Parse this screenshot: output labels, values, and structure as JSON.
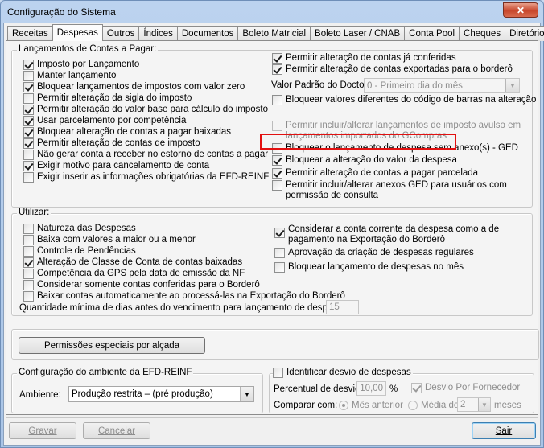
{
  "window": {
    "title": "Configuração do Sistema",
    "close_glyph": "✕"
  },
  "tabs": [
    "Receitas",
    "Despesas",
    "Outros",
    "Índices",
    "Documentos",
    "Boleto Matricial",
    "Boleto Laser / CNAB",
    "Conta Pool",
    "Cheques",
    "Diretórios"
  ],
  "lancamentos": {
    "title": "Lançamentos de Contas a Pagar:",
    "left": [
      {
        "label": "Imposto por Lançamento",
        "checked": true
      },
      {
        "label": "Manter lançamento",
        "checked": false
      },
      {
        "label": "Bloquear lançamentos de impostos com valor zero",
        "checked": true
      },
      {
        "label": "Permitir alteração da sigla do imposto",
        "checked": false
      },
      {
        "label": "Permitir alteração do valor base para cálculo do imposto",
        "checked": true
      },
      {
        "label": "Usar parcelamento por competência",
        "checked": true
      },
      {
        "label": "Bloquear alteração de contas a pagar baixadas",
        "checked": true
      },
      {
        "label": "Permitir alteração de contas de imposto",
        "checked": true
      },
      {
        "label": "Não gerar conta a receber no estorno de contas a pagar",
        "checked": false
      },
      {
        "label": "Exigir motivo para cancelamento de conta",
        "checked": true
      },
      {
        "label": "Exigir inserir as informações obrigatórias da EFD-REINF",
        "checked": false
      }
    ],
    "right_top": [
      {
        "label": "Permitir alteração de contas já conferidas",
        "checked": true
      },
      {
        "label": "Permitir alteração de contas exportadas para o borderô",
        "checked": true
      }
    ],
    "valor_padrao_label": "Valor Padrão do Docto.",
    "valor_padrao_value": "0 - Primeiro dia do mês",
    "bloquear_codigo_barras": {
      "label": "Bloquear valores diferentes do código de barras na alteração",
      "checked": false
    },
    "permitir_avulso": {
      "line1": "Permitir incluir/alterar lançamentos de imposto avulso em",
      "line2": "lançamentos importados do GCompras",
      "checked": false
    },
    "bloquear_sem_anexo": {
      "label": "Bloquear o lançamento de despesa sem anexo(s) - GED",
      "checked": false
    },
    "bloquear_valor_despesa": {
      "label": "Bloquear a alteração do valor da despesa",
      "checked": true
    },
    "permitir_parcelada": {
      "label": "Permitir alteração de contas a pagar parcelada",
      "checked": true
    },
    "permitir_anexos": {
      "line1": "Permitir incluir/alterar anexos GED para usuários com",
      "line2": "permissão de consulta",
      "checked": false
    }
  },
  "utilizar": {
    "title": "Utilizar:",
    "left": [
      {
        "label": "Natureza das Despesas",
        "checked": false
      },
      {
        "label": "Baixa com valores a maior ou a menor",
        "checked": false
      },
      {
        "label": "Controle de Pendências",
        "checked": false
      },
      {
        "label": "Alteração de Classe de Conta de contas baixadas",
        "checked": true
      },
      {
        "label": "Competência da GPS pela data de emissão da NF",
        "checked": false
      },
      {
        "label": "Considerar somente contas conferidas para o Borderô",
        "checked": false
      },
      {
        "label": "Baixar contas automaticamente ao processá-las na Exportação do Borderô",
        "checked": false
      }
    ],
    "considerar": {
      "line1": "Considerar a conta corrente da despesa como a de",
      "line2": "pagamento na Exportação do Borderô",
      "checked": true
    },
    "aprovacao": {
      "label": "Aprovação da criação de despesas regulares",
      "checked": false
    },
    "bloquear_mes": {
      "label": "Bloquear lançamento de despesas no mês",
      "checked": false
    },
    "qtd_label": "Quantidade mínima de dias antes do vencimento para lançamento de despesa:",
    "qtd_value": "15"
  },
  "permissoes_button": "Permissões especiais por alçada",
  "efd": {
    "title": "Configuração do ambiente da EFD-REINF",
    "ambiente_label": "Ambiente:",
    "ambiente_value": "Produção restrita – (pré produção)"
  },
  "desvio": {
    "title": "Identificar desvio de despesas",
    "checked": false,
    "percentual_label": "Percentual de desvio",
    "percentual_value": "10,00",
    "percentual_unit": "%",
    "por_fornecedor": {
      "label": "Desvio Por Fornecedor",
      "checked": true
    },
    "comparar_label": "Comparar com:",
    "mes_anterior": "Mês anterior",
    "media_de": "Média de",
    "media_value": "2",
    "meses": "meses"
  },
  "footer": {
    "gravar": "Gravar",
    "cancelar": "Cancelar",
    "sair": "Sair"
  }
}
